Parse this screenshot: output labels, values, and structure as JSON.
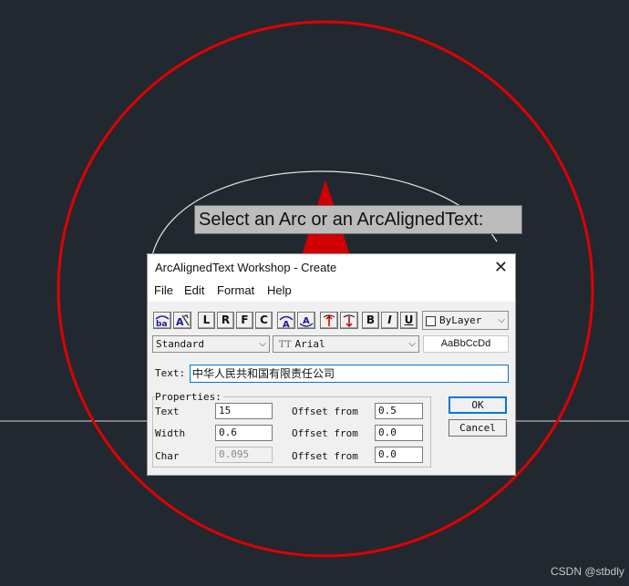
{
  "prompt_text": "Select an Arc or an ArcAlignedText:",
  "watermark": "CSDN @stbdly",
  "colors": {
    "background": "#212830",
    "outer_circle": "#e00000",
    "inner_arc": "#ffffff",
    "dialog": "#f0f0f0",
    "accent": "#0078d7"
  },
  "dialog": {
    "title": "ArcAlignedText Workshop - Create",
    "close_glyph": "✕",
    "menu": [
      "File",
      "Edit",
      "Format",
      "Help"
    ],
    "toolbar": {
      "letters": [
        "L",
        "R",
        "F",
        "C"
      ],
      "style_buttons": [
        "B",
        "I",
        "U"
      ],
      "color_value": "ByLayer",
      "style_value": "Standard",
      "font_prefix": "TT",
      "font_value": "Arial",
      "preview_text": "AaBbCcDd"
    },
    "text_label": "Text:",
    "text_value": "中华人民共和国有限责任公司",
    "properties_legend": "Properties:",
    "properties": [
      {
        "label": "Text",
        "value": "15",
        "offset_label": "Offset from",
        "offset_value": "0.5",
        "disabled": false
      },
      {
        "label": "Width",
        "value": "0.6",
        "offset_label": "Offset from",
        "offset_value": "0.0",
        "disabled": false
      },
      {
        "label": "Char",
        "value": "0.095",
        "offset_label": "Offset from",
        "offset_value": "0.0",
        "disabled": true
      }
    ],
    "ok_label": "OK",
    "cancel_label": "Cancel"
  }
}
